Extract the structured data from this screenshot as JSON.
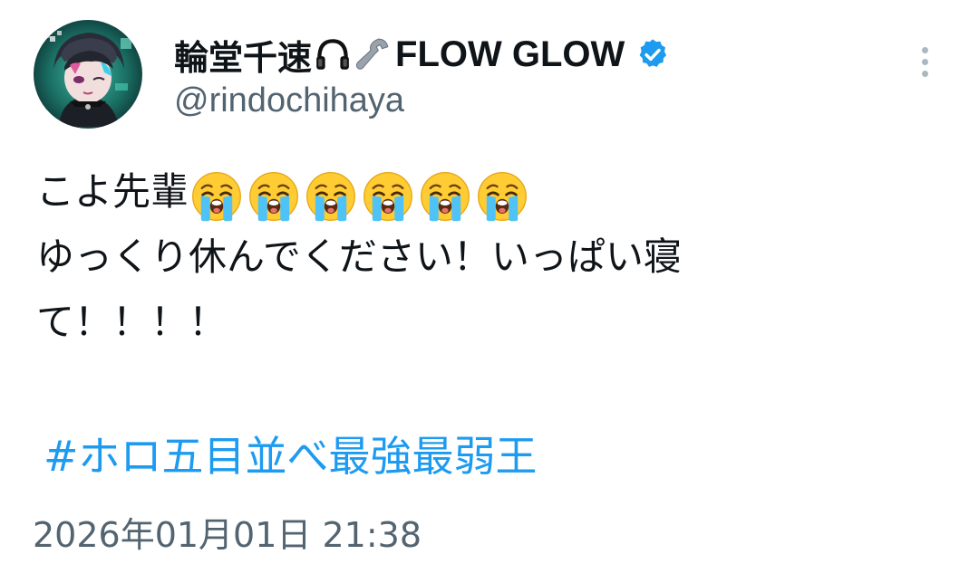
{
  "author": {
    "display_name": "輪堂千速",
    "display_name_suffix": "FLOW GLOW",
    "handle": "@rindochihaya",
    "verified_color": "#1d9bf0"
  },
  "icons": {
    "name_icons": [
      "headphones-icon",
      "wrench-icon"
    ],
    "verified": "verified-badge-icon",
    "more": "more-options-icon",
    "emoji": "loudly-crying-face-emoji"
  },
  "tweet": {
    "line1_text": "こよ先輩",
    "line1_emoji_count": 6,
    "line2_text": "ゆっくり休んでください！いっぱい寝",
    "line3_text": "て！！！！",
    "hashtag": "#ホロ五目並べ最強最弱王",
    "timestamp": "2026年01月01日 21:38"
  },
  "colors": {
    "link": "#1d9bf0",
    "secondary_text": "#536471",
    "primary_text": "#0f1419"
  }
}
